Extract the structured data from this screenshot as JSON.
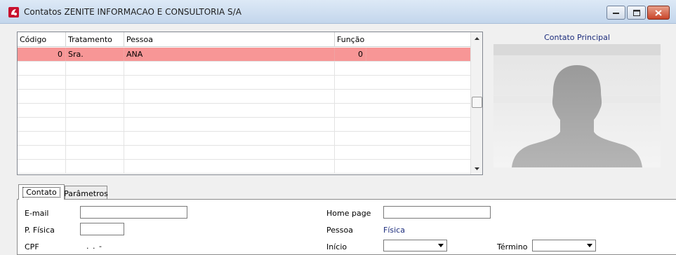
{
  "window": {
    "title": "Contatos ZENITE INFORMACAO E CONSULTORIA S/A"
  },
  "grid": {
    "columns": [
      "Código",
      "Tratamento",
      "Pessoa",
      "Função"
    ],
    "rows": [
      {
        "codigo": "0",
        "tratamento": "Sra.",
        "pessoa": "ANA",
        "funcao": "0"
      }
    ]
  },
  "photo": {
    "title": "Contato Principal",
    "icon": "person-silhouette-icon"
  },
  "tabs": [
    "Contato",
    "Parâmetros"
  ],
  "form": {
    "email_label": "E-mail",
    "email_value": "",
    "homepage_label": "Home page",
    "homepage_value": "",
    "pfisica_label": "P. Física",
    "pfisica_value": "",
    "pessoa_label": "Pessoa",
    "pessoa_value": "Física",
    "cpf_label": "CPF",
    "cpf_value": ". . -",
    "inicio_label": "Início",
    "inicio_value": "",
    "termino_label": "Término",
    "termino_value": ""
  },
  "colors": {
    "selected_row": "#f79696",
    "accent_text": "#1c2c7c"
  }
}
